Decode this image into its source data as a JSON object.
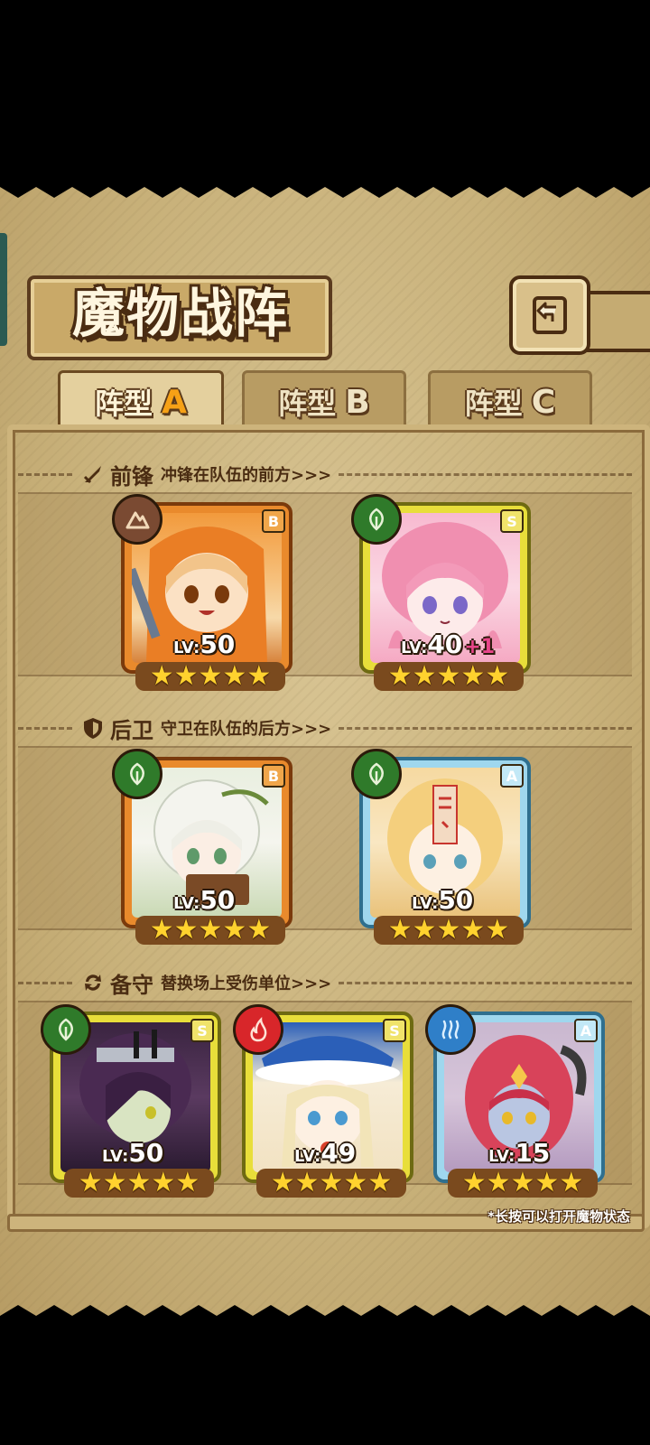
{
  "title": "魔物战阵",
  "tabs": [
    {
      "label": "阵型",
      "letter": "A",
      "active": true
    },
    {
      "label": "阵型",
      "letter": "B",
      "active": false
    },
    {
      "label": "阵型",
      "letter": "C",
      "active": false
    }
  ],
  "sections": {
    "front": {
      "label": "前锋",
      "desc": "冲锋在队伍的前方>>>",
      "icon": "sword-icon"
    },
    "rear": {
      "label": "后卫",
      "desc": "守卫在队伍的后方>>>",
      "icon": "shield-icon"
    },
    "reserve": {
      "label": "备守",
      "desc": "替换场上受伤单位>>>",
      "icon": "swap-icon"
    }
  },
  "units": {
    "front1": {
      "level": "50",
      "rank": "B",
      "element": "earth",
      "stars": "★★★★★",
      "plus": ""
    },
    "front2": {
      "level": "40",
      "rank": "S",
      "element": "leaf",
      "stars": "★★★★★",
      "plus": "+1"
    },
    "rear1": {
      "level": "50",
      "rank": "B",
      "element": "leaf",
      "stars": "★★★★★",
      "plus": ""
    },
    "rear2": {
      "level": "50",
      "rank": "A",
      "element": "leaf",
      "stars": "★★★★★",
      "plus": ""
    },
    "res1": {
      "level": "50",
      "rank": "S",
      "element": "leaf",
      "stars": "★★★★★",
      "plus": ""
    },
    "res2": {
      "level": "49",
      "rank": "S",
      "element": "fire",
      "stars": "★★★★★",
      "plus": ""
    },
    "res3": {
      "level": "15",
      "rank": "A",
      "element": "water",
      "stars": "★★★★★",
      "plus": ""
    }
  },
  "lv_prefix": "LV:",
  "footnote": "*长按可以打开魔物状态",
  "colors": {
    "rankB": "#e98a2c",
    "rankS": "#e8de3a",
    "rankA": "#9fd7ee",
    "leaf": "#2f7a2a",
    "earth": "#7a4a32",
    "fire": "#d8262a",
    "water": "#2f7fc8"
  }
}
